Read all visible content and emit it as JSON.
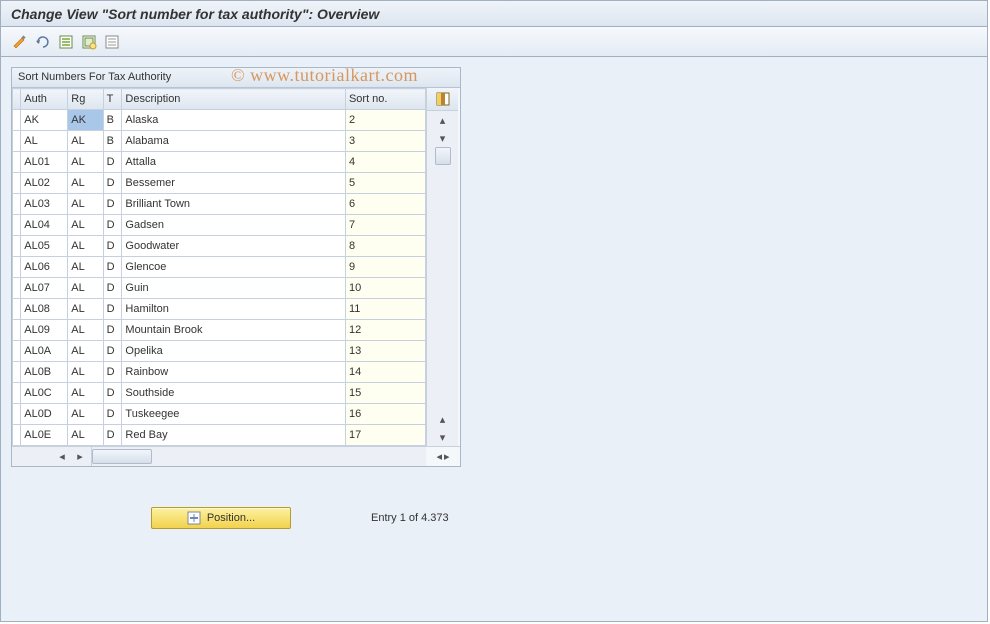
{
  "title": "Change View \"Sort number for tax authority\": Overview",
  "watermark": "© www.tutorialkart.com",
  "panel": {
    "title": "Sort Numbers For Tax Authority"
  },
  "columns": {
    "auth": "Auth",
    "rg": "Rg",
    "t": "T",
    "desc": "Description",
    "sort": "Sort no."
  },
  "rows": [
    {
      "auth": "AK",
      "rg": "AK",
      "t": "B",
      "desc": "Alaska",
      "sort": "2",
      "selected": true
    },
    {
      "auth": "AL",
      "rg": "AL",
      "t": "B",
      "desc": "Alabama",
      "sort": "3"
    },
    {
      "auth": "AL01",
      "rg": "AL",
      "t": "D",
      "desc": "Attalla",
      "sort": "4"
    },
    {
      "auth": "AL02",
      "rg": "AL",
      "t": "D",
      "desc": "Bessemer",
      "sort": "5"
    },
    {
      "auth": "AL03",
      "rg": "AL",
      "t": "D",
      "desc": "Brilliant Town",
      "sort": "6"
    },
    {
      "auth": "AL04",
      "rg": "AL",
      "t": "D",
      "desc": "Gadsen",
      "sort": "7"
    },
    {
      "auth": "AL05",
      "rg": "AL",
      "t": "D",
      "desc": "Goodwater",
      "sort": "8"
    },
    {
      "auth": "AL06",
      "rg": "AL",
      "t": "D",
      "desc": "Glencoe",
      "sort": "9"
    },
    {
      "auth": "AL07",
      "rg": "AL",
      "t": "D",
      "desc": "Guin",
      "sort": "10"
    },
    {
      "auth": "AL08",
      "rg": "AL",
      "t": "D",
      "desc": "Hamilton",
      "sort": "11"
    },
    {
      "auth": "AL09",
      "rg": "AL",
      "t": "D",
      "desc": "Mountain Brook",
      "sort": "12"
    },
    {
      "auth": "AL0A",
      "rg": "AL",
      "t": "D",
      "desc": "Opelika",
      "sort": "13"
    },
    {
      "auth": "AL0B",
      "rg": "AL",
      "t": "D",
      "desc": "Rainbow",
      "sort": "14"
    },
    {
      "auth": "AL0C",
      "rg": "AL",
      "t": "D",
      "desc": "Southside",
      "sort": "15"
    },
    {
      "auth": "AL0D",
      "rg": "AL",
      "t": "D",
      "desc": "Tuskeegee",
      "sort": "16"
    },
    {
      "auth": "AL0E",
      "rg": "AL",
      "t": "D",
      "desc": "Red Bay",
      "sort": "17"
    }
  ],
  "position_button": "Position...",
  "entry_info": "Entry 1 of 4.373"
}
